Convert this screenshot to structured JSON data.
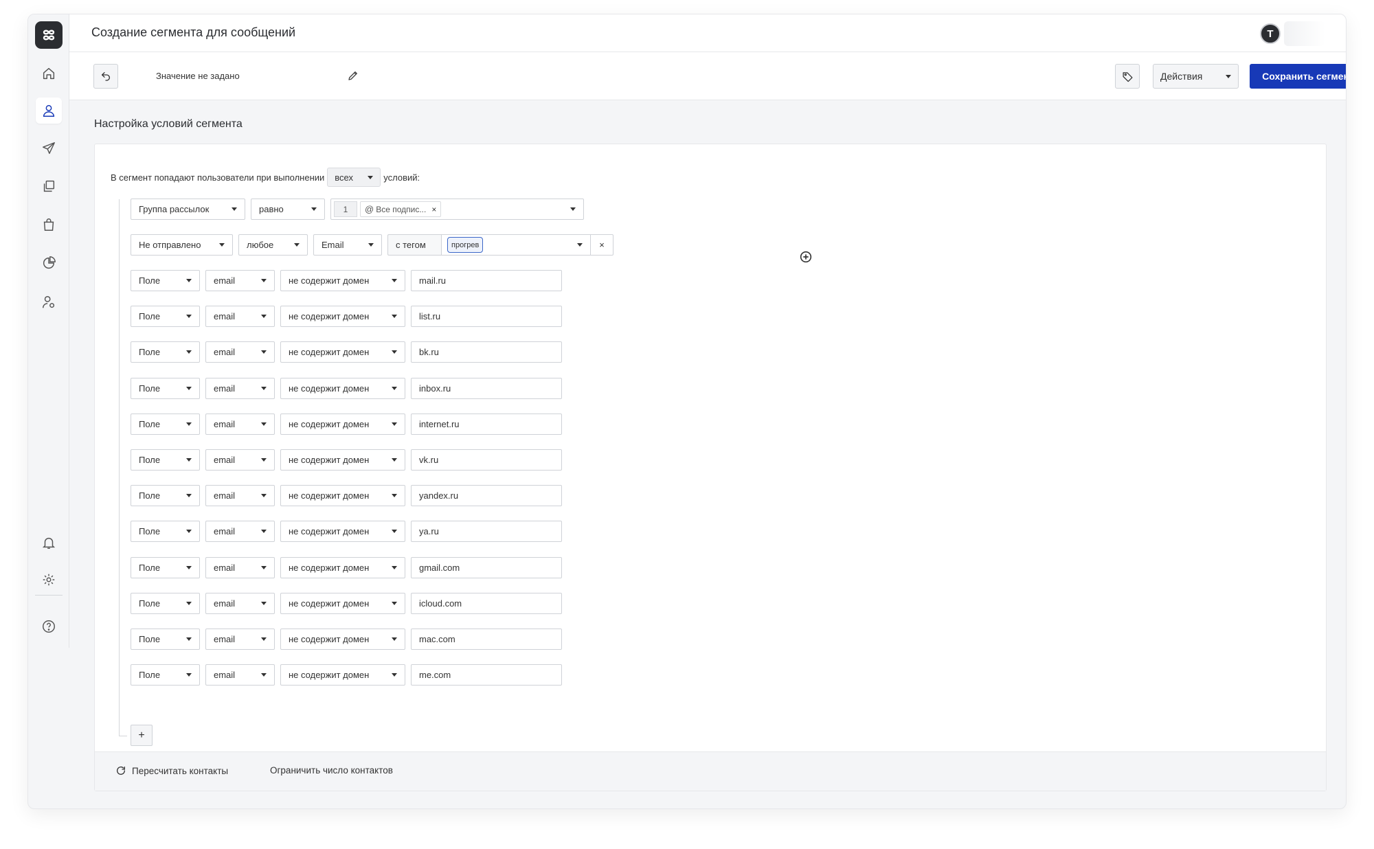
{
  "header": {
    "title": "Создание сегмента для сообщений",
    "avatar_letter": "T"
  },
  "toolbar": {
    "value_label": "Значение не задано",
    "actions_label": "Действия",
    "save_label": "Сохранить сегмент"
  },
  "sidebar": {
    "items": [
      {
        "icon": "home-icon"
      },
      {
        "icon": "contacts-icon"
      },
      {
        "icon": "send-icon"
      },
      {
        "icon": "templates-icon"
      },
      {
        "icon": "shopping-bag-icon"
      },
      {
        "icon": "pie-chart-icon"
      },
      {
        "icon": "user-settings-icon"
      },
      {
        "icon": "bell-icon"
      },
      {
        "icon": "gear-icon"
      },
      {
        "icon": "help-icon"
      }
    ]
  },
  "section": {
    "title": "Настройка условий сегмента"
  },
  "intro": {
    "before": "В сегмент попадают пользователи при выполнении",
    "mode": "всех",
    "after": "условий:"
  },
  "conditions": {
    "group": {
      "type": "Группа рассылок",
      "operator": "равно",
      "count": "1",
      "chip": "Все подпис...",
      "chip_close": "×"
    },
    "sent": {
      "type": "Не отправлено",
      "scope": "любое",
      "channel": "Email",
      "tag_label": "с тегом",
      "tag": "прогрев",
      "clear": "×"
    },
    "field_rows": [
      {
        "type": "Поле",
        "field": "email",
        "operator": "не содержит домен",
        "value": "mail.ru"
      },
      {
        "type": "Поле",
        "field": "email",
        "operator": "не содержит домен",
        "value": "list.ru"
      },
      {
        "type": "Поле",
        "field": "email",
        "operator": "не содержит домен",
        "value": "bk.ru"
      },
      {
        "type": "Поле",
        "field": "email",
        "operator": "не содержит домен",
        "value": "inbox.ru"
      },
      {
        "type": "Поле",
        "field": "email",
        "operator": "не содержит домен",
        "value": "internet.ru"
      },
      {
        "type": "Поле",
        "field": "email",
        "operator": "не содержит домен",
        "value": "vk.ru"
      },
      {
        "type": "Поле",
        "field": "email",
        "operator": "не содержит домен",
        "value": "yandex.ru"
      },
      {
        "type": "Поле",
        "field": "email",
        "operator": "не содержит домен",
        "value": "ya.ru"
      },
      {
        "type": "Поле",
        "field": "email",
        "operator": "не содержит домен",
        "value": "gmail.com"
      },
      {
        "type": "Поле",
        "field": "email",
        "operator": "не содержит домен",
        "value": "icloud.com"
      },
      {
        "type": "Поле",
        "field": "email",
        "operator": "не содержит домен",
        "value": "mac.com"
      },
      {
        "type": "Поле",
        "field": "email",
        "operator": "не содержит домен",
        "value": "me.com"
      }
    ],
    "add_label": "+"
  },
  "footer": {
    "recalculate": "Пересчитать контакты",
    "limit": "Ограничить число контактов"
  },
  "colors": {
    "primary": "#1739b7",
    "tag_border": "#3a66c8"
  }
}
